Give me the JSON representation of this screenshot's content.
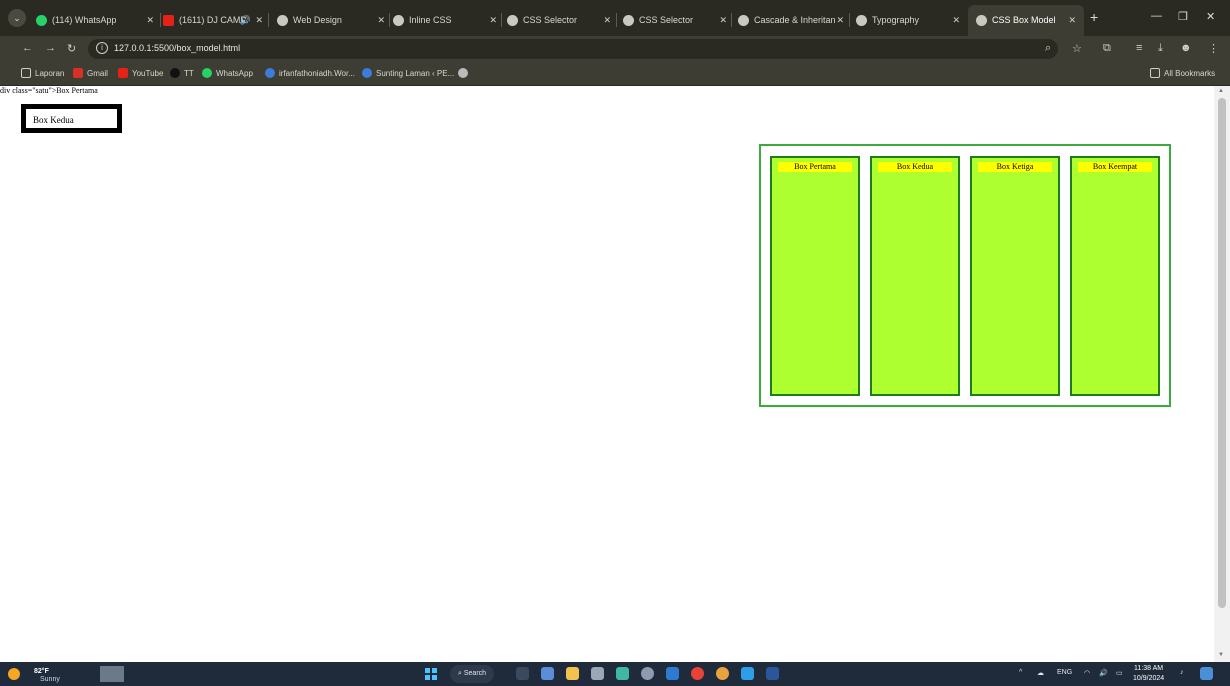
{
  "browser": {
    "tabs": [
      {
        "label": "(114) WhatsApp",
        "icon": "whatsapp-icon"
      },
      {
        "label": "(1611) DJ CAMP",
        "icon": "youtube-icon",
        "audio": "🔊"
      },
      {
        "label": "Web Design",
        "icon": "globe-icon"
      },
      {
        "label": "Inline CSS",
        "icon": "globe-icon"
      },
      {
        "label": "CSS Selector",
        "icon": "globe-icon"
      },
      {
        "label": "CSS Selector",
        "icon": "globe-icon"
      },
      {
        "label": "Cascade & Inheritan",
        "icon": "globe-icon"
      },
      {
        "label": "Typography",
        "icon": "globe-icon"
      },
      {
        "label": "CSS Box Model",
        "icon": "globe-icon",
        "active": true
      }
    ],
    "url": "127.0.0.1:5500/box_model.html",
    "bookmarks": [
      {
        "label": "Laporan",
        "icon": "folder-icon"
      },
      {
        "label": "Gmail",
        "icon": "gmail-icon"
      },
      {
        "label": "YouTube",
        "icon": "youtube-icon"
      },
      {
        "label": "TT",
        "icon": "tiktok-icon"
      },
      {
        "label": "WhatsApp",
        "icon": "whatsapp-icon"
      },
      {
        "label": "irfanfathoniadh.Wor...",
        "icon": "wordpress-icon"
      },
      {
        "label": "Sunting Laman ‹ PE...",
        "icon": "wordpress-icon"
      },
      {
        "label": "",
        "icon": "globe-icon"
      }
    ],
    "all_bookmarks": "All Bookmarks"
  },
  "page": {
    "raw_text": "div class=\"satu\">Box Pertama",
    "box_kedua_label": "Box Kedua",
    "boxes": [
      "Box Pertama",
      "Box Kedua",
      "Box Ketiga",
      "Box Keempat"
    ],
    "colors": {
      "box_fill": "#adff2f",
      "box_border": "#1c7d1c",
      "title_bg": "#ffff00",
      "container_border": "#3caa3c"
    }
  },
  "taskbar": {
    "weather_temp": "82°F",
    "weather_condition": "Sunny",
    "search_label": "Search",
    "language": "ENG",
    "time": "11:38 AM",
    "date": "10/9/2024"
  }
}
